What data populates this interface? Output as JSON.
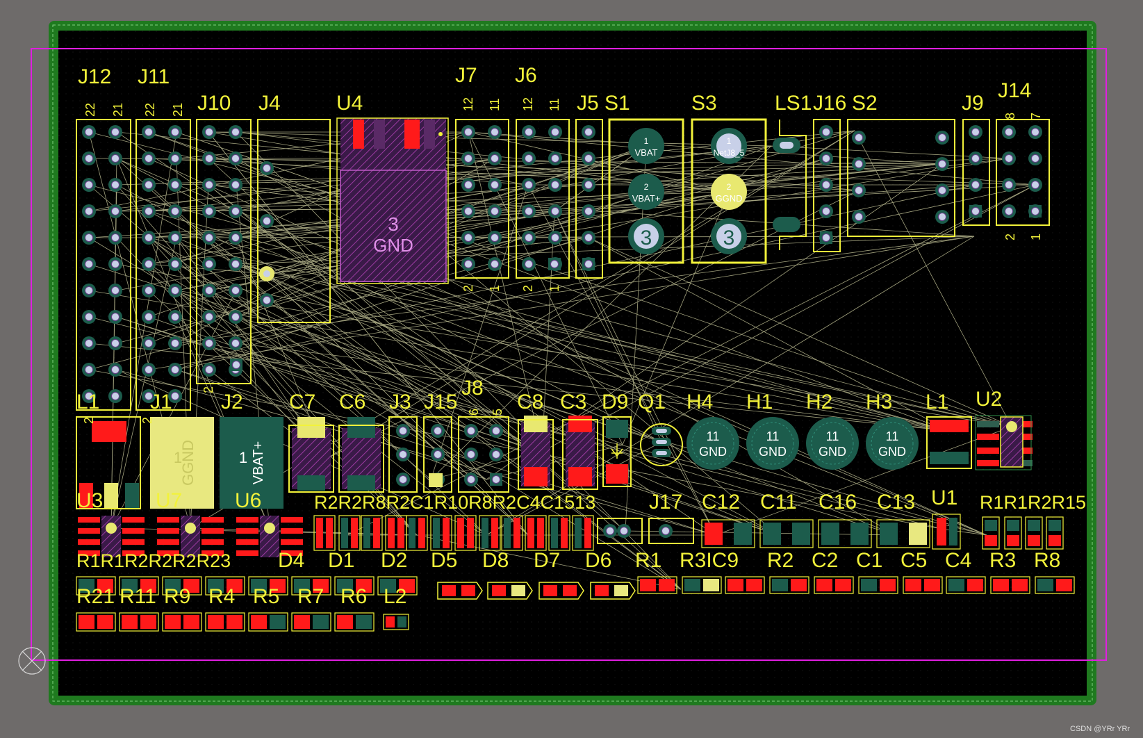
{
  "watermark": "CSDN @YRr YRr",
  "colors": {
    "background": "#6e6b6a",
    "board_outline": "#1f7a1f",
    "board_fill": "#000000",
    "keepout": "#e01ee0",
    "silkscreen": "#f2f23a",
    "pad_top": "#ff1a1a",
    "pad_multi": "#1c5c4c",
    "ratsnest": "#d9d9a8",
    "hole": "#c8d0e8"
  },
  "component_labels": {
    "J12": "J12",
    "J11": "J11",
    "J10": "J10",
    "J4": "J4",
    "U4": "U4",
    "J7": "J7",
    "J6": "J6",
    "J5": "J5",
    "S1": "S1",
    "S3": "S3",
    "LS1": "LS1",
    "J16": "J16",
    "S2": "S2",
    "J9": "J9",
    "J14": "J14",
    "L1a": "L1",
    "J1": "J1",
    "J2": "J2",
    "C7": "C7",
    "C6": "C6",
    "J3": "J3",
    "J15": "J15",
    "J8": "J8",
    "C8": "C8",
    "C3": "C3",
    "D9": "D9",
    "Q1": "Q1",
    "H4": "H4",
    "H1": "H1",
    "H2": "H2",
    "H3": "H3",
    "L1b": "L1",
    "U2": "U2",
    "U3": "U3",
    "U7": "U7",
    "U6": "U6",
    "U1": "U1",
    "J17": "J17",
    "C12": "C12",
    "C11": "C11",
    "C16": "C16",
    "C13": "C13",
    "D4": "D4",
    "D1": "D1",
    "D2": "D2",
    "D5": "D5",
    "D8": "D8",
    "D7": "D7",
    "D6": "D6",
    "R1": "R1",
    "R3C9": "R3IC9",
    "R2": "R2",
    "C2": "C2",
    "C1": "C1",
    "C5": "C5",
    "C4": "C4",
    "R3": "R3",
    "R8": "R8",
    "R21": "R21",
    "R11": "R11",
    "R9": "R9",
    "R4": "R4",
    "R5": "R5",
    "R7": "R7",
    "R6": "R6",
    "L2": "L2",
    "row2_group": "R1R1R2R2R2R23",
    "row1_group": "R2R2R8R2C1R10R8R2C4C1513",
    "right_group": "R1R1R2R15"
  },
  "pin_numbers": {
    "j12_top": [
      "22",
      "21"
    ],
    "j11_top": [
      "22",
      "21"
    ],
    "j7_top": [
      "12",
      "11"
    ],
    "j6_top": [
      "12",
      "11"
    ],
    "j7_bottom": [
      "2",
      "1"
    ],
    "j6_bottom": [
      "2",
      "1"
    ],
    "j14_top": [
      "8",
      "7"
    ],
    "j14_bottom": [
      "2",
      "1"
    ],
    "j8_top": [
      "6",
      "5"
    ],
    "j10_bottom": "2",
    "l1_bottom": "2",
    "j1_bottom": "2"
  },
  "net_labels": {
    "u4_center_num": "3",
    "u4_center_net": "GND",
    "s1_pad1": "1",
    "s1_net1": "VBAT",
    "s1_pad2": "2",
    "s1_net2": "VBAT+",
    "s1_pad3": "3",
    "s3_pad1": "1",
    "s3_net1": "NetJ8_5",
    "s3_pad2": "2",
    "s3_net2": "GGND",
    "s3_pad3": "3",
    "j1_num": "1",
    "j1_net": "GGND",
    "j2_num": "1",
    "j2_net": "VBAT+",
    "hole_num": "11",
    "hole_net": "GND"
  }
}
